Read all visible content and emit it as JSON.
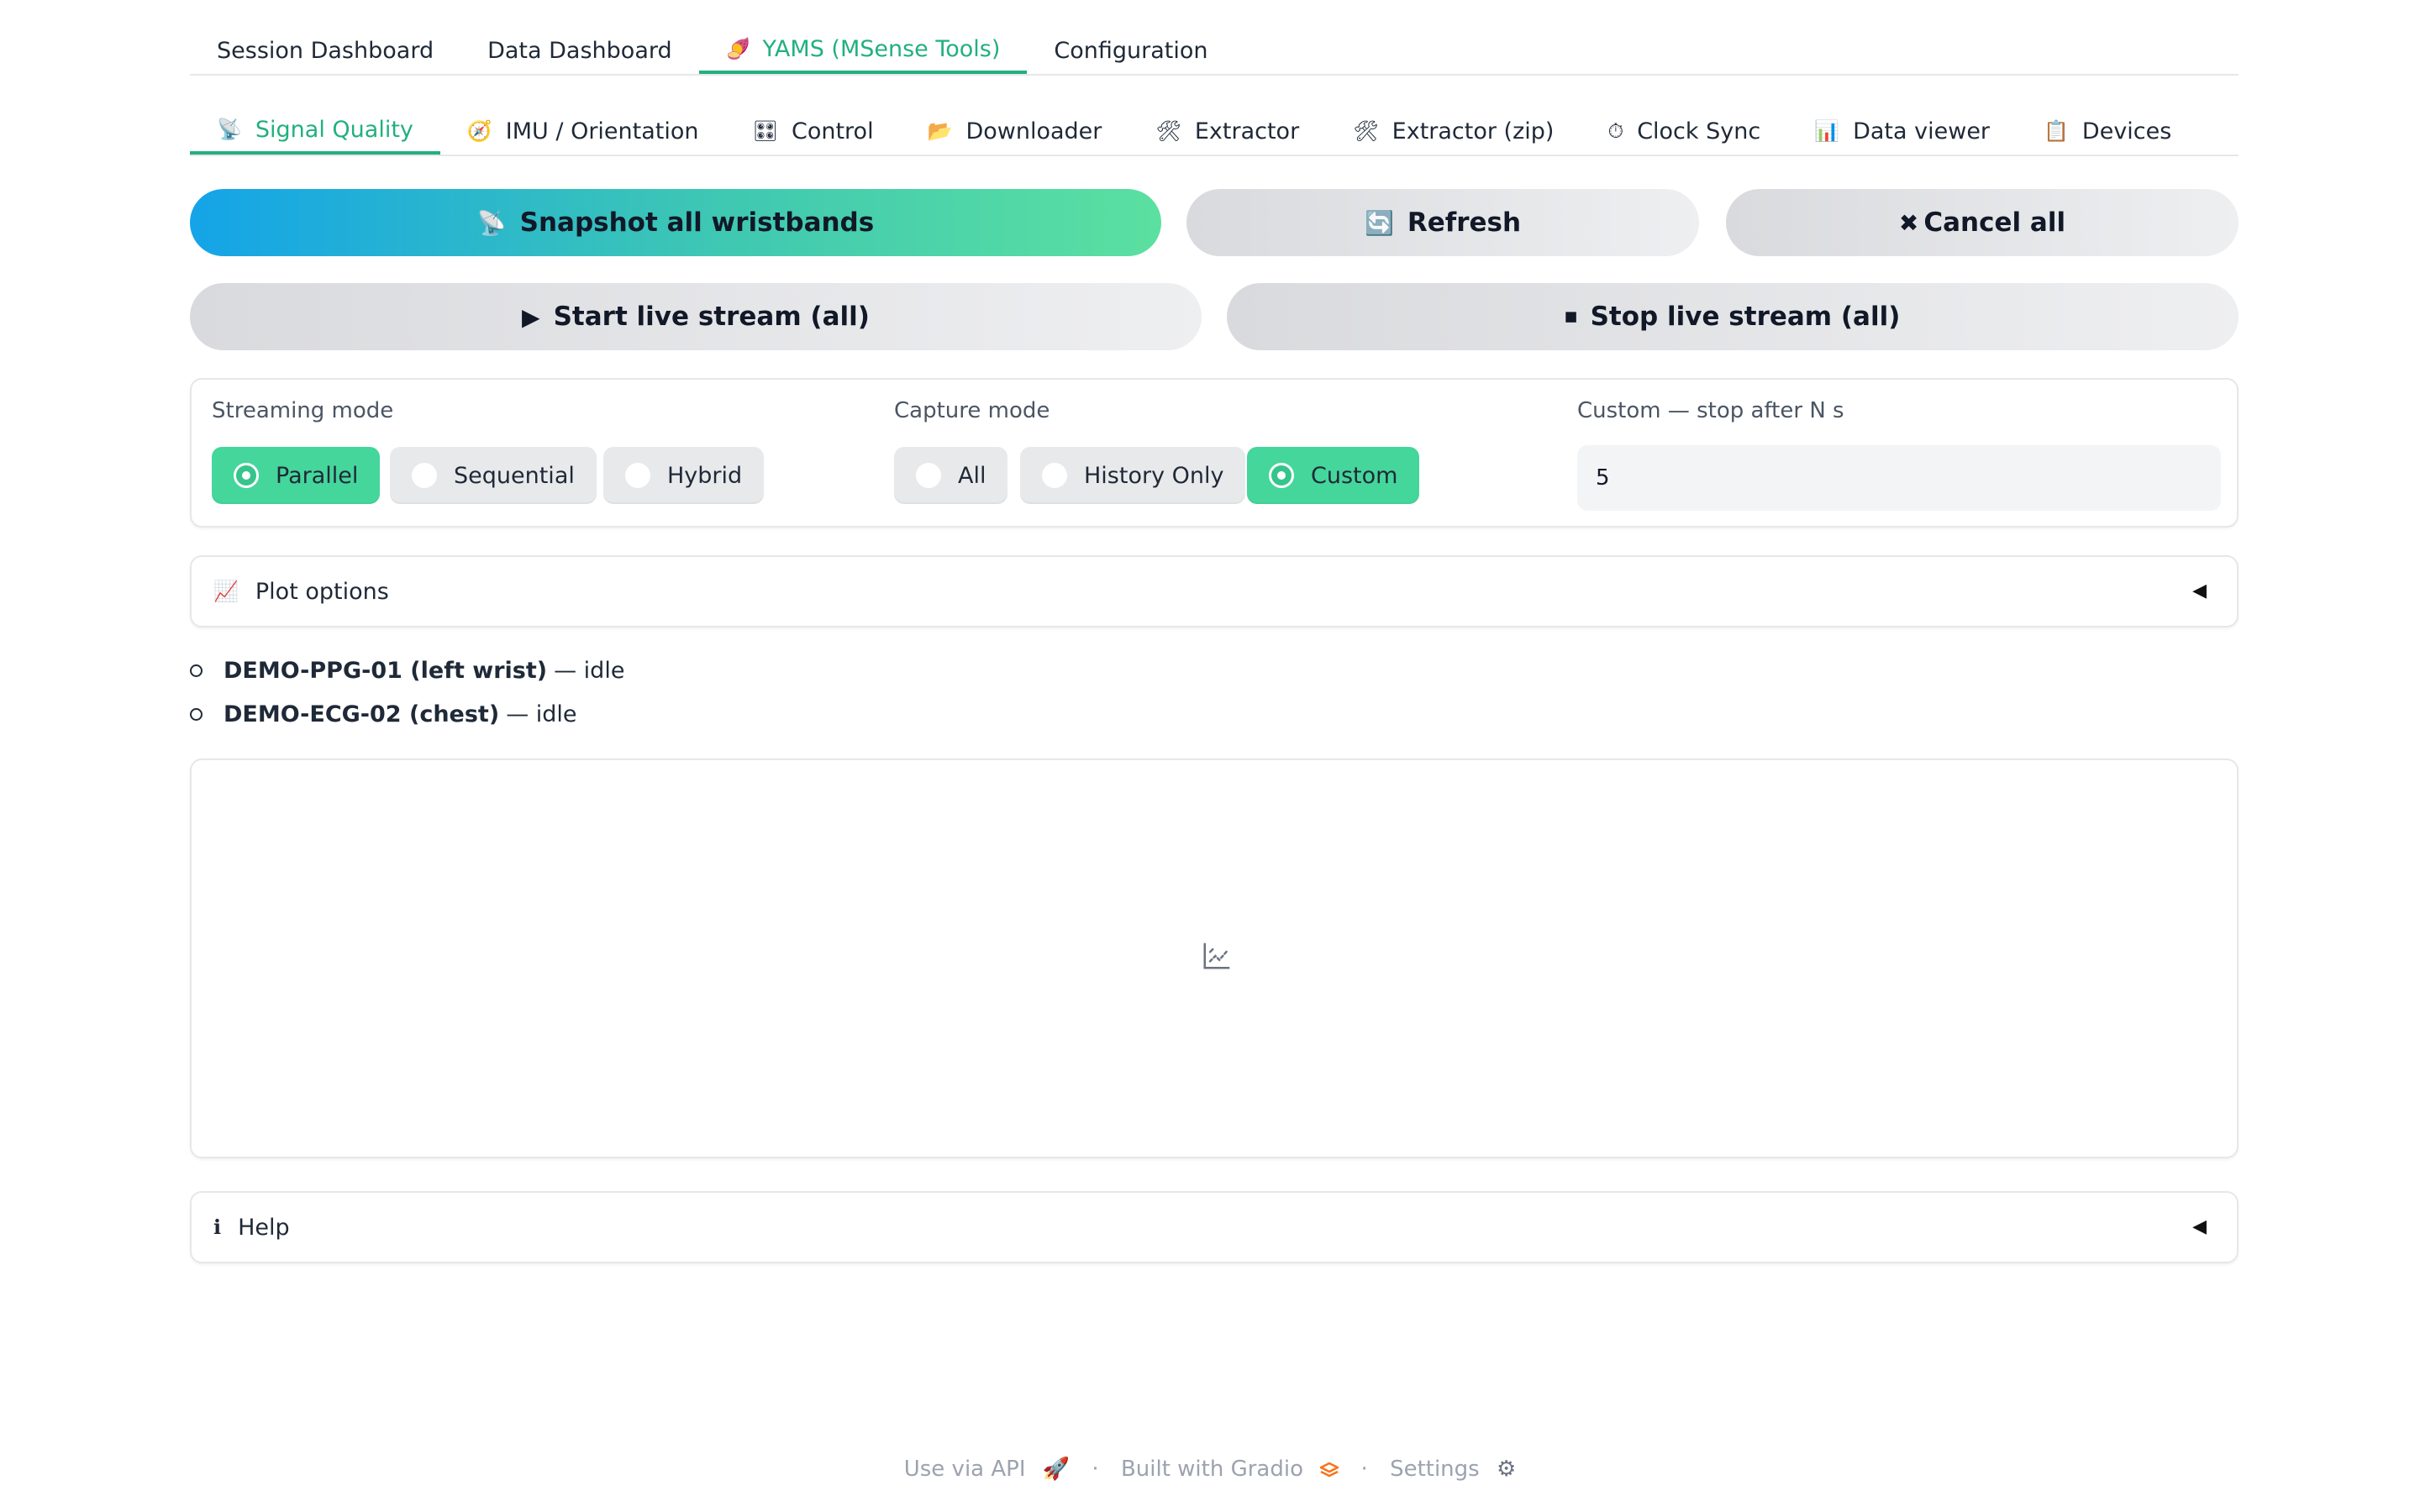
{
  "top_tabs": [
    {
      "label": "Session Dashboard",
      "icon": ""
    },
    {
      "label": "Data Dashboard",
      "icon": ""
    },
    {
      "label": "YAMS (MSense Tools)",
      "icon": "🍠"
    },
    {
      "label": "Configuration",
      "icon": ""
    }
  ],
  "sub_tabs": [
    {
      "label": "Signal Quality",
      "icon": "📡"
    },
    {
      "label": "IMU / Orientation",
      "icon": "🧭"
    },
    {
      "label": "Control",
      "icon": "🎛"
    },
    {
      "label": "Downloader",
      "icon": "📂"
    },
    {
      "label": "Extractor",
      "icon": "🛠"
    },
    {
      "label": "Extractor (zip)",
      "icon": "🛠"
    },
    {
      "label": "Clock Sync",
      "icon": "⏱"
    },
    {
      "label": "Data viewer",
      "icon": "📊"
    },
    {
      "label": "Devices",
      "icon": "📋"
    }
  ],
  "actions": {
    "snapshot": {
      "label": "Snapshot all wristbands",
      "icon": "📡"
    },
    "refresh": {
      "label": "Refresh",
      "icon": "🔄"
    },
    "cancel": {
      "label": "Cancel all",
      "icon": "✖"
    },
    "start_stream": {
      "label": "Start live stream (all)",
      "icon": "▶"
    },
    "stop_stream": {
      "label": "Stop live stream (all)",
      "icon": "⏹"
    }
  },
  "streaming_mode": {
    "label": "Streaming mode",
    "options": [
      "Parallel",
      "Sequential",
      "Hybrid"
    ],
    "selected": "Parallel"
  },
  "capture_mode": {
    "label": "Capture mode",
    "options": [
      "All",
      "History Only",
      "Custom"
    ],
    "selected": "Custom"
  },
  "custom_stop": {
    "label": "Custom — stop after N s",
    "value": "5"
  },
  "plot_options": {
    "label": "Plot options",
    "icon": "📈"
  },
  "devices": [
    {
      "name": "DEMO-PPG-01 (left wrist)",
      "status": "— idle"
    },
    {
      "name": "DEMO-ECG-02 (chest)",
      "status": "— idle"
    }
  ],
  "help": {
    "label": "Help",
    "icon": "ℹ"
  },
  "footer": {
    "api": "Use via API",
    "api_icon": "🚀",
    "built": "Built with Gradio",
    "built_icon": "logo",
    "settings": "Settings",
    "settings_icon": "⚙",
    "sep": "·"
  },
  "colors": {
    "accent": "#22b07d",
    "selected": "#45d69c"
  }
}
